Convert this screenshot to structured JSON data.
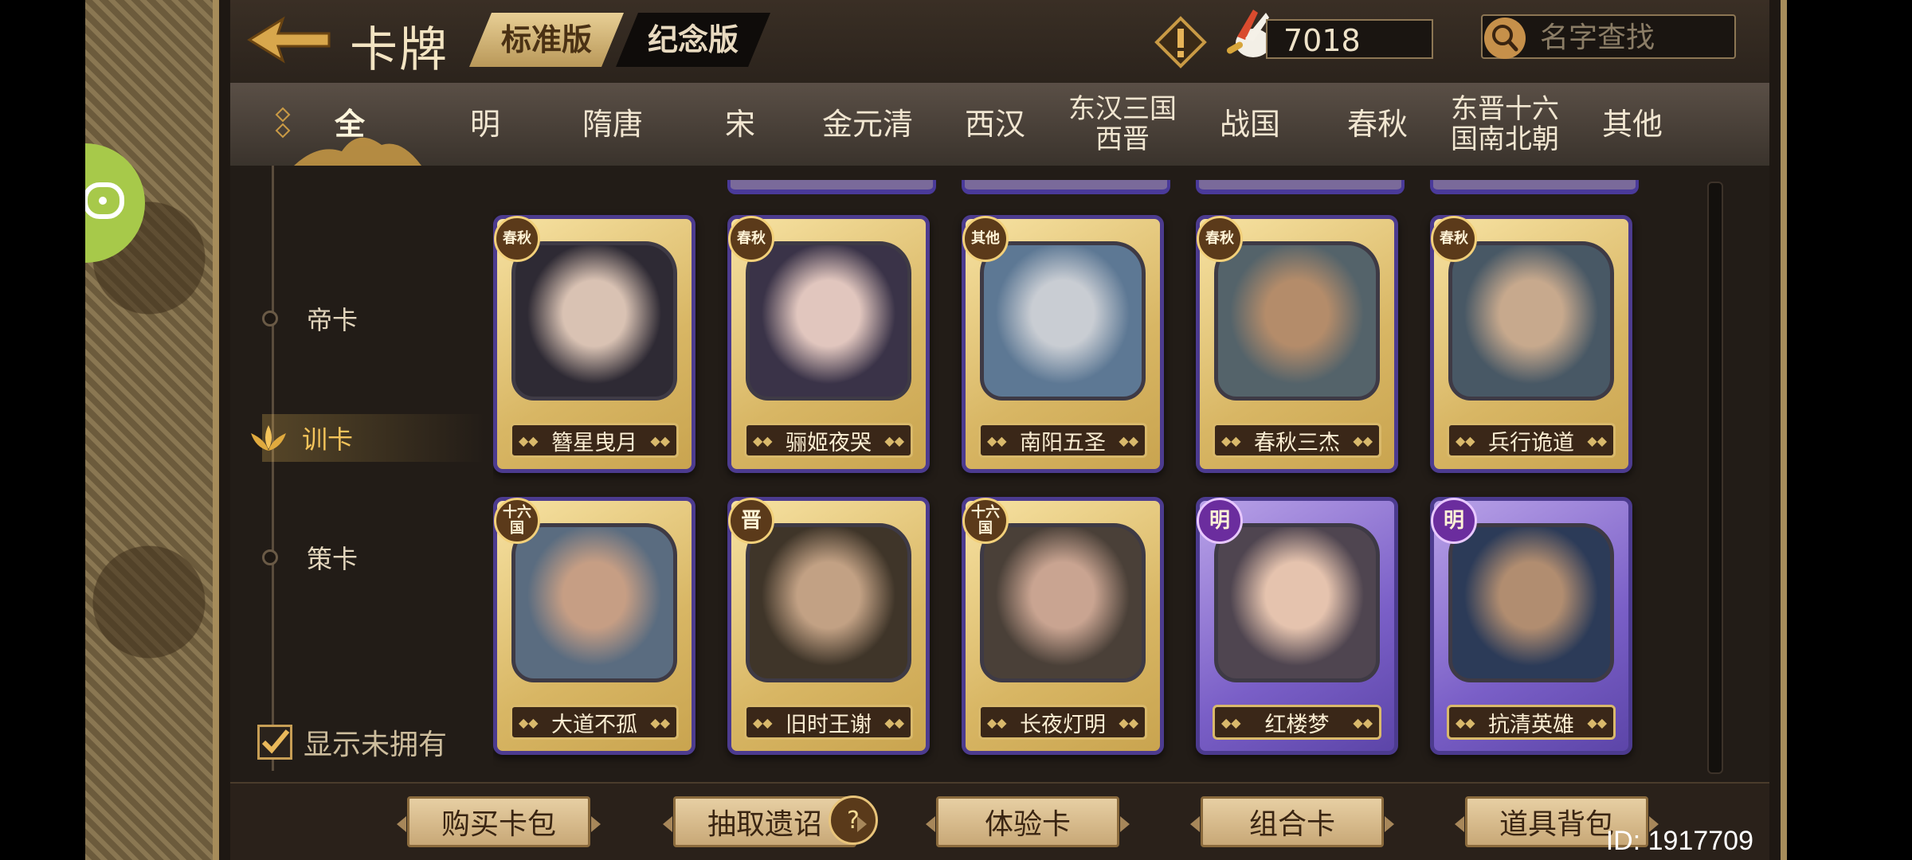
{
  "header": {
    "title": "卡牌",
    "version_tabs": [
      "标准版",
      "纪念版"
    ],
    "currency_value": "7018",
    "search_placeholder": "名字查找"
  },
  "era_tabs": [
    {
      "label": "全",
      "active": true
    },
    {
      "label": "明"
    },
    {
      "label": "隋唐"
    },
    {
      "label": "宋"
    },
    {
      "label": "金元清"
    },
    {
      "label": "西汉"
    },
    {
      "label": "东汉三国\n西晋"
    },
    {
      "label": "战国"
    },
    {
      "label": "春秋"
    },
    {
      "label": "东晋十六\n国南北朝"
    },
    {
      "label": "其他"
    }
  ],
  "categories": [
    {
      "label": "帝卡"
    },
    {
      "label": "训卡",
      "active": true
    },
    {
      "label": "策卡"
    }
  ],
  "show_unowned": {
    "label": "显示未拥有",
    "checked": true
  },
  "cards": [
    {
      "name": "簪星曳月",
      "era": "春秋",
      "frame": "gold"
    },
    {
      "name": "骊姬夜哭",
      "era": "春秋",
      "frame": "gold"
    },
    {
      "name": "南阳五圣",
      "era": "其他",
      "frame": "gold"
    },
    {
      "name": "春秋三杰",
      "era": "春秋",
      "frame": "gold"
    },
    {
      "name": "兵行诡道",
      "era": "春秋",
      "frame": "gold"
    },
    {
      "name": "大道不孤",
      "era": "十六国",
      "frame": "gold"
    },
    {
      "name": "旧时王谢",
      "era": "晋",
      "frame": "gold"
    },
    {
      "name": "长夜灯明",
      "era": "十六国",
      "frame": "gold"
    },
    {
      "name": "红楼梦",
      "era": "明",
      "frame": "purple"
    },
    {
      "name": "抗清英雄",
      "era": "明",
      "frame": "purple"
    }
  ],
  "bottom_buttons": [
    "购买卡包",
    "抽取遗诏",
    "体验卡",
    "组合卡",
    "道具背包"
  ],
  "player_id": "ID: 1917709",
  "colors": {
    "accent_gold": "#d9b96b",
    "active_category": "#f4c45b",
    "ming_badge": "#6b2d9e"
  }
}
